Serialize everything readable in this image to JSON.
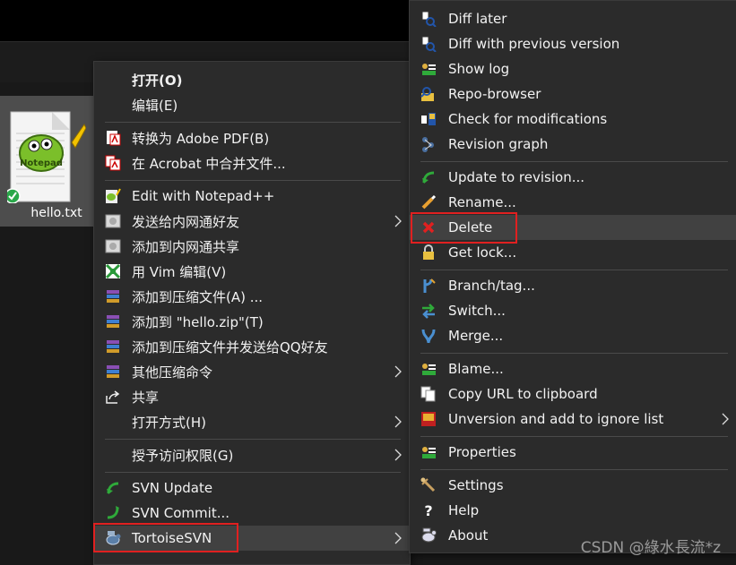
{
  "file": {
    "name": "hello.txt",
    "icon": "notepadpp-file-icon",
    "status_badge": "svn-normal-checkmark"
  },
  "context_menu": {
    "items": [
      {
        "label": "打开(O)",
        "icon": "none",
        "bold": true
      },
      {
        "label": "编辑(E)",
        "icon": "none"
      },
      {
        "label": "转换为 Adobe PDF(B)",
        "icon": "adobe-pdf-icon"
      },
      {
        "label": "在 Acrobat 中合并文件...",
        "icon": "acrobat-combine-icon"
      },
      {
        "label": "Edit with Notepad++",
        "icon": "notepadpp-icon"
      },
      {
        "label": "发送给内网通好友",
        "icon": "intranet-icon",
        "submenu": true
      },
      {
        "label": "添加到内网通共享",
        "icon": "intranet-icon"
      },
      {
        "label": "用 Vim 编辑(V)",
        "icon": "vim-icon"
      },
      {
        "label": "添加到压缩文件(A) ...",
        "icon": "winrar-icon"
      },
      {
        "label": "添加到 \"hello.zip\"(T)",
        "icon": "winrar-icon"
      },
      {
        "label": "添加到压缩文件并发送给QQ好友",
        "icon": "winrar-icon"
      },
      {
        "label": "其他压缩命令",
        "icon": "winrar-icon",
        "submenu": true
      },
      {
        "label": "共享",
        "icon": "share-icon"
      },
      {
        "label": "打开方式(H)",
        "icon": "none",
        "submenu": true
      },
      {
        "label": "授予访问权限(G)",
        "icon": "none",
        "submenu": true
      },
      {
        "label": "SVN Update",
        "icon": "svn-update-icon"
      },
      {
        "label": "SVN Commit...",
        "icon": "svn-commit-icon"
      },
      {
        "label": "TortoiseSVN",
        "icon": "tortoisesvn-icon",
        "submenu": true
      }
    ]
  },
  "svn_submenu": {
    "items": [
      {
        "label": "Diff later",
        "icon": "diff-later-icon"
      },
      {
        "label": "Diff with previous version",
        "icon": "diff-icon"
      },
      {
        "label": "Show log",
        "icon": "show-log-icon"
      },
      {
        "label": "Repo-browser",
        "icon": "repo-browser-icon"
      },
      {
        "label": "Check for modifications",
        "icon": "check-modifications-icon"
      },
      {
        "label": "Revision graph",
        "icon": "revision-graph-icon"
      },
      {
        "label": "Update to revision...",
        "icon": "update-revision-icon"
      },
      {
        "label": "Rename...",
        "icon": "rename-icon"
      },
      {
        "label": "Delete",
        "icon": "delete-icon"
      },
      {
        "label": "Get lock...",
        "icon": "lock-icon"
      },
      {
        "label": "Branch/tag...",
        "icon": "branch-icon"
      },
      {
        "label": "Switch...",
        "icon": "switch-icon"
      },
      {
        "label": "Merge...",
        "icon": "merge-icon"
      },
      {
        "label": "Blame...",
        "icon": "blame-icon"
      },
      {
        "label": "Copy URL to clipboard",
        "icon": "copy-url-icon"
      },
      {
        "label": "Unversion and add to ignore list",
        "icon": "ignore-icon",
        "submenu": true
      },
      {
        "label": "Properties",
        "icon": "properties-icon"
      },
      {
        "label": "Settings",
        "icon": "settings-icon"
      },
      {
        "label": "Help",
        "icon": "help-icon"
      },
      {
        "label": "About",
        "icon": "about-icon"
      }
    ]
  },
  "watermark": "CSDN @綠水長流*z",
  "colors": {
    "menu_bg": "#2b2b2b",
    "highlight": "#414141",
    "annotation_red": "#e02020",
    "file_selected": "#4d4d4d"
  }
}
